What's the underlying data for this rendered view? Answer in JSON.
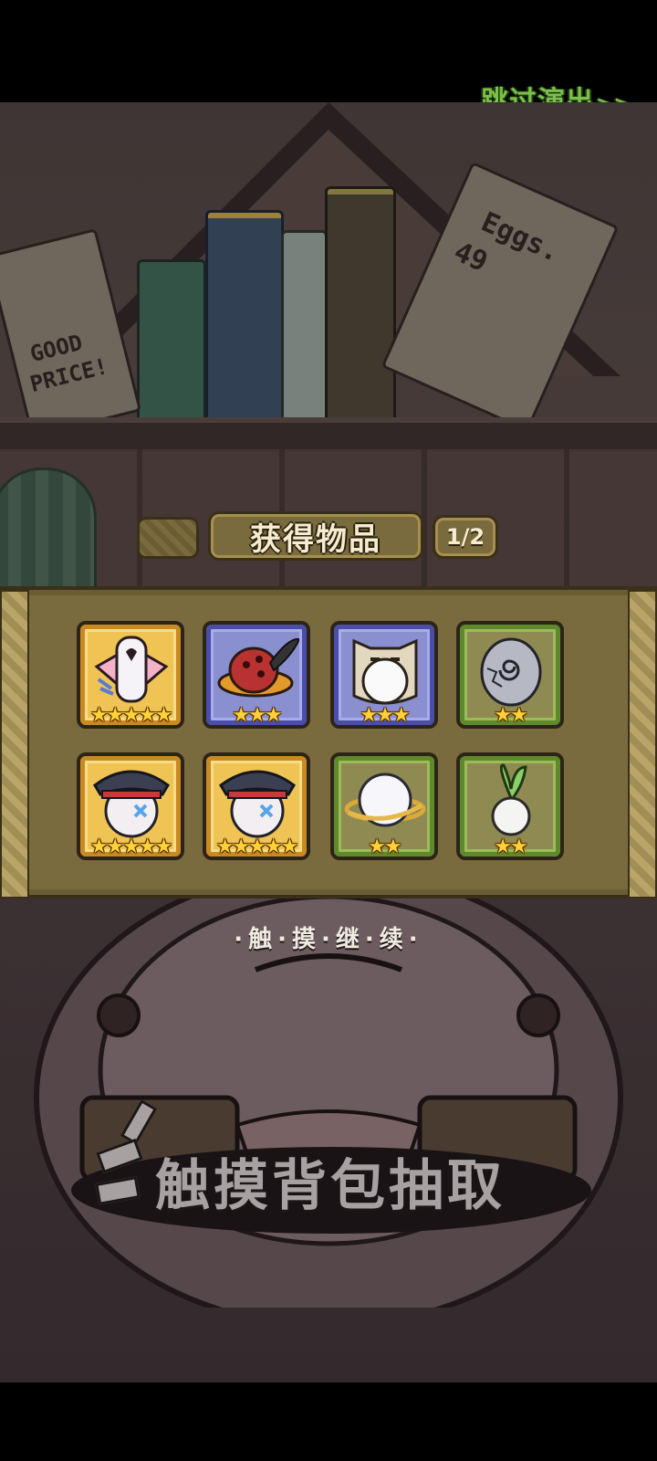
{
  "header": {
    "skip_label": "跳过演出",
    "skip_arrows": ">>"
  },
  "background": {
    "paper_left": {
      "line1": "GOOD",
      "line2": "PRICE!"
    },
    "paper_right": {
      "line1": "Eggs.",
      "line2": "49"
    }
  },
  "panel": {
    "title": "获得物品",
    "page": "1/2",
    "items": [
      {
        "name": "white-fairy-bow",
        "frame": "gold",
        "stars": "★★★★★",
        "star_count": 5
      },
      {
        "name": "mushroom-feather-hat",
        "frame": "blue",
        "stars": "★★★",
        "star_count": 3
      },
      {
        "name": "cat-hood-egg",
        "frame": "blue",
        "stars": "★★★",
        "star_count": 3
      },
      {
        "name": "stone-egg",
        "frame": "green",
        "stars": "★★",
        "star_count": 2
      },
      {
        "name": "captain-hat-egg",
        "frame": "gold",
        "stars": "★★★★★",
        "star_count": 5
      },
      {
        "name": "captain-hat-egg",
        "frame": "gold",
        "stars": "★★★★★",
        "star_count": 5
      },
      {
        "name": "cloud-planet",
        "frame": "green",
        "stars": "★★",
        "star_count": 2
      },
      {
        "name": "radish",
        "frame": "green",
        "stars": "★★",
        "star_count": 2
      }
    ]
  },
  "continue_hint": "·触·摸·继·续·",
  "bag_hint": "触摸背包抽取",
  "colors": {
    "gold": "#efc454",
    "blue": "#8a8fd0",
    "green": "#8f8a52",
    "skip_text": "#7cbf4a",
    "star": "#ffd23a"
  }
}
